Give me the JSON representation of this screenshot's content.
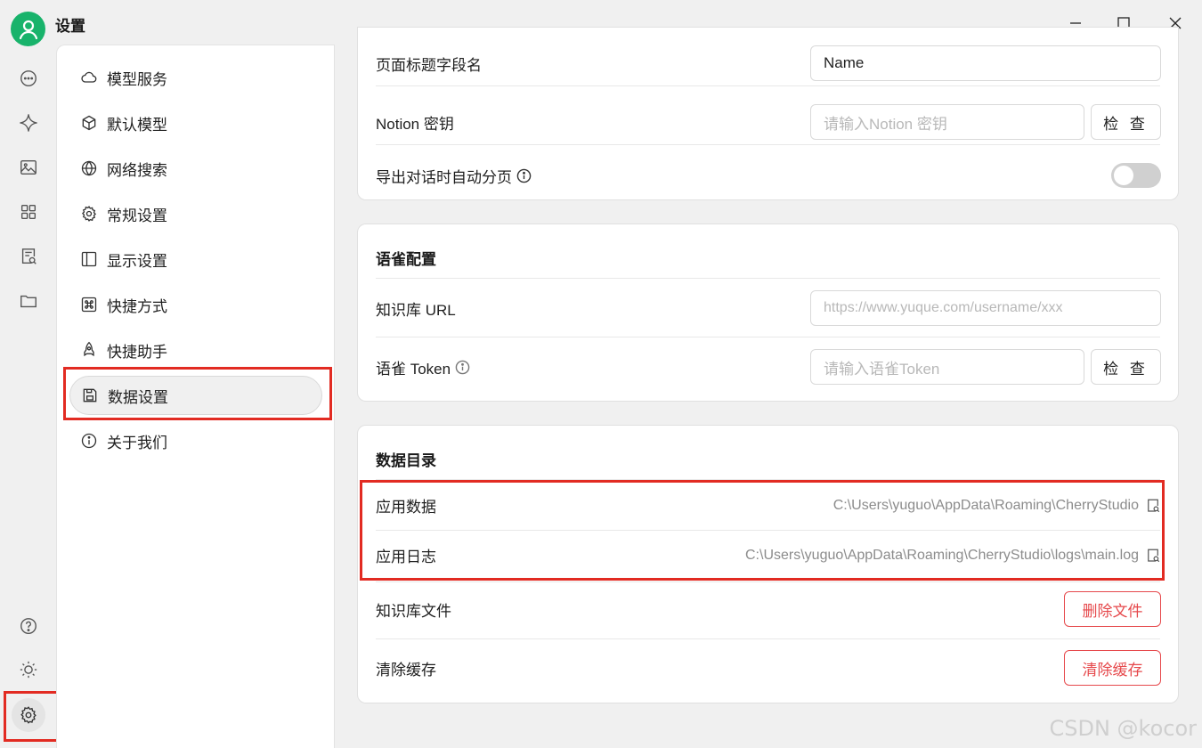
{
  "window": {
    "title": "设置"
  },
  "rail": {
    "items": [
      "chat-icon",
      "sparkle-icon",
      "image-icon",
      "apps-icon",
      "doc-search-icon",
      "folder-icon"
    ],
    "bottom": [
      "help-icon",
      "sun-icon",
      "gear-icon"
    ]
  },
  "menu": {
    "items": [
      {
        "label": "模型服务",
        "icon": "cloud-icon"
      },
      {
        "label": "默认模型",
        "icon": "cube-icon"
      },
      {
        "label": "网络搜索",
        "icon": "globe-icon"
      },
      {
        "label": "常规设置",
        "icon": "gear-icon"
      },
      {
        "label": "显示设置",
        "icon": "layout-icon"
      },
      {
        "label": "快捷方式",
        "icon": "command-icon"
      },
      {
        "label": "快捷助手",
        "icon": "rocket-icon"
      },
      {
        "label": "数据设置",
        "icon": "save-icon"
      },
      {
        "label": "关于我们",
        "icon": "info-icon"
      }
    ],
    "active_index": 7
  },
  "notion": {
    "page_title_field_label": "页面标题字段名",
    "page_title_field_value": "Name",
    "key_label": "Notion 密钥",
    "key_placeholder": "请输入Notion 密钥",
    "check_label": "检 查",
    "auto_paging_label": "导出对话时自动分页",
    "auto_paging_enabled": false
  },
  "yuque": {
    "title": "语雀配置",
    "url_label": "知识库 URL",
    "url_placeholder": "https://www.yuque.com/username/xxx",
    "token_label": "语雀 Token",
    "token_placeholder": "请输入语雀Token",
    "check_label": "检 查"
  },
  "data_dir": {
    "title": "数据目录",
    "app_data_label": "应用数据",
    "app_data_path": "C:\\Users\\yuguo\\AppData\\Roaming\\CherryStudio",
    "app_log_label": "应用日志",
    "app_log_path": "C:\\Users\\yuguo\\AppData\\Roaming\\CherryStudio\\logs\\main.log",
    "kb_files_label": "知识库文件",
    "delete_files_label": "删除文件",
    "clear_cache_label": "清除缓存",
    "clear_cache_button": "清除缓存"
  },
  "watermark": "CSDN @kocor",
  "colors": {
    "accent_green": "#18b36b",
    "danger": "#e6494c",
    "highlight_box": "#e22b22"
  }
}
